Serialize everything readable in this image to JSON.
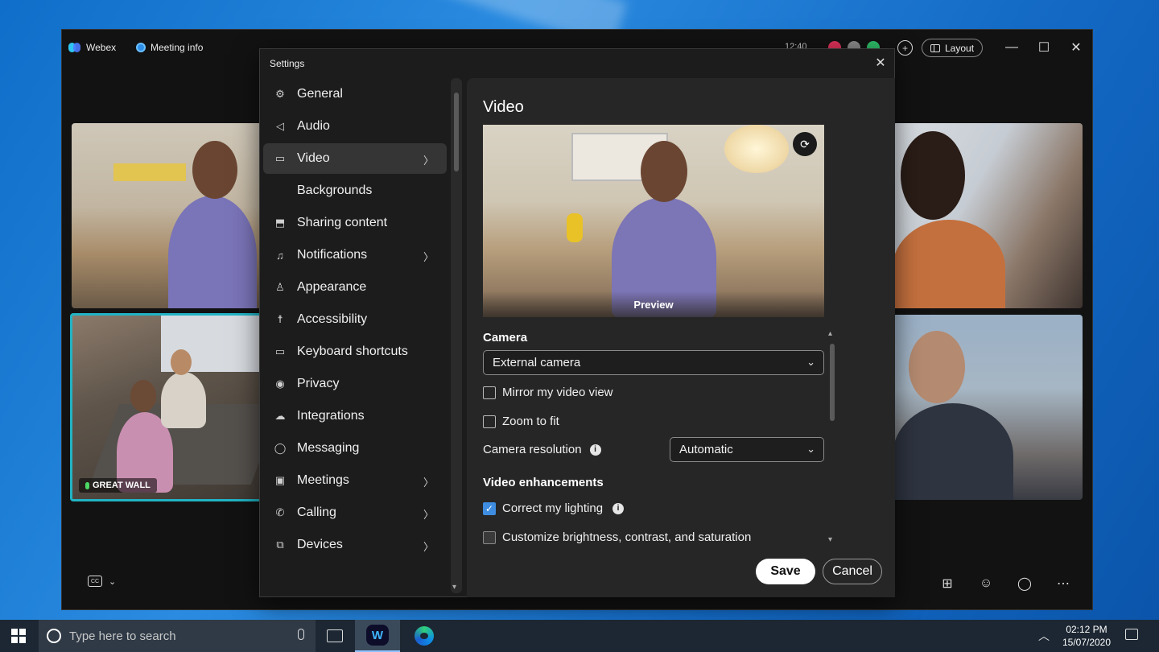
{
  "window": {
    "app_name": "Webex",
    "meeting_info": "Meeting info",
    "time": "12:40",
    "layout_label": "Layout"
  },
  "tiles": {
    "room_label": "GREAT WALL"
  },
  "settings": {
    "title": "Settings",
    "nav": [
      {
        "label": "General",
        "icon": "gear-icon",
        "chevron": false
      },
      {
        "label": "Audio",
        "icon": "speaker-icon",
        "chevron": false
      },
      {
        "label": "Video",
        "icon": "video-camera-icon",
        "chevron": true,
        "active": true
      },
      {
        "label": "Backgrounds",
        "icon": "",
        "chevron": false
      },
      {
        "label": "Sharing content",
        "icon": "share-screen-icon",
        "chevron": false
      },
      {
        "label": "Notifications",
        "icon": "bell-icon",
        "chevron": true
      },
      {
        "label": "Appearance",
        "icon": "paint-icon",
        "chevron": false
      },
      {
        "label": "Accessibility",
        "icon": "accessibility-icon",
        "chevron": false
      },
      {
        "label": "Keyboard shortcuts",
        "icon": "keyboard-icon",
        "chevron": false
      },
      {
        "label": "Privacy",
        "icon": "privacy-icon",
        "chevron": false
      },
      {
        "label": "Integrations",
        "icon": "cloud-icon",
        "chevron": false
      },
      {
        "label": "Messaging",
        "icon": "chat-bubble-icon",
        "chevron": false
      },
      {
        "label": "Meetings",
        "icon": "calendar-icon",
        "chevron": true
      },
      {
        "label": "Calling",
        "icon": "phone-icon",
        "chevron": true
      },
      {
        "label": "Devices",
        "icon": "devices-icon",
        "chevron": true
      }
    ],
    "video": {
      "title": "Video",
      "preview_label": "Preview",
      "camera_label": "Camera",
      "camera_value": "External camera",
      "mirror_label": "Mirror my video view",
      "mirror_checked": false,
      "zoom_label": "Zoom to fit",
      "zoom_checked": false,
      "resolution_label": "Camera resolution",
      "resolution_value": "Automatic",
      "enhancements_label": "Video enhancements",
      "lighting_label": "Correct my lighting",
      "lighting_checked": true,
      "brightness_label": "Customize brightness, contrast, and saturation",
      "brightness_checked": false
    },
    "save_label": "Save",
    "cancel_label": "Cancel"
  },
  "taskbar": {
    "search_placeholder": "Type here to search",
    "time": "02:12 PM",
    "date": "15/07/2020"
  },
  "colors": {
    "accent": "#3e8de0",
    "active_speaker_border": "#21b3c4",
    "dialog_bg": "#1c1c1c",
    "content_bg": "#262626"
  }
}
